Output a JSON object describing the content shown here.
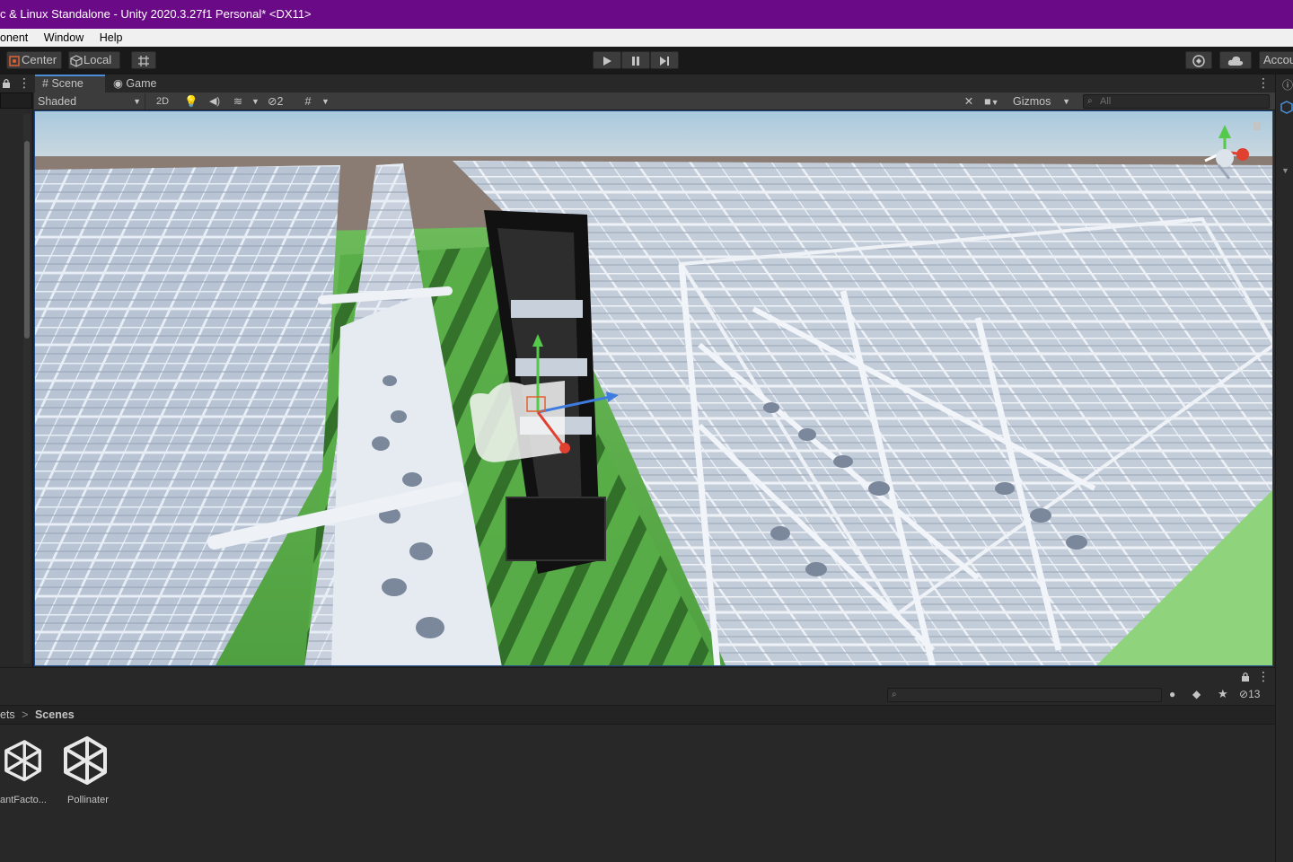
{
  "window": {
    "title": "c & Linux Standalone - Unity 2020.3.27f1 Personal* <DX11>"
  },
  "menu": {
    "items": [
      "onent",
      "Window",
      "Help"
    ]
  },
  "toolbar": {
    "center_label": "Center",
    "local_label": "Local",
    "account_label": "Accou"
  },
  "scene_tabs": {
    "scene_label": "Scene",
    "game_label": "Game"
  },
  "scene_controls": {
    "shading_mode": "Shaded",
    "mode_2d": "2D",
    "hidden_count": "2",
    "gizmos_label": "Gizmos",
    "search_placeholder": "All"
  },
  "project": {
    "hidden_count": "13",
    "breadcrumb_root": "ets",
    "breadcrumb_sep": ">",
    "breadcrumb_current": "Scenes",
    "assets": [
      {
        "name": "antFacto..."
      },
      {
        "name": "Pollinater"
      }
    ]
  },
  "icons": [
    "play-icon",
    "pause-icon",
    "step-icon",
    "lock-icon",
    "kebab-icon",
    "collab-icon",
    "cloud-icon",
    "grid-icon",
    "gizmo-axis-icon"
  ],
  "colors": {
    "title_bar": "#6b0a86",
    "ground": "#5fb04f",
    "viewport_border": "#1f4d8a"
  }
}
